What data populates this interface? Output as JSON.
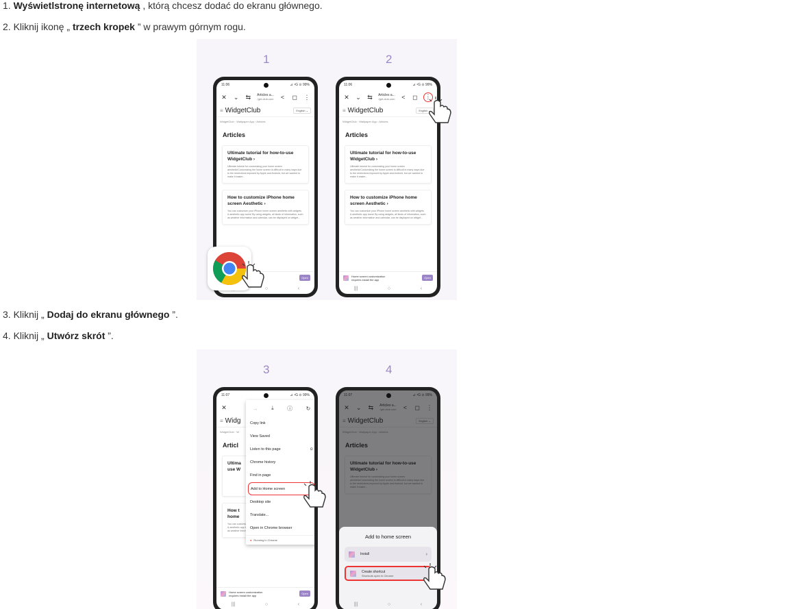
{
  "steps": [
    {
      "prefix": "1. ",
      "bold": "Wyświetlstronę internetową",
      "suffix": " , którą chcesz dodać do ekranu głównego."
    },
    {
      "prefix": "2. Kliknij ikonę „ ",
      "bold": "trzech kropek",
      "suffix": " ” w prawym górnym rogu."
    },
    {
      "prefix": "3. Kliknij „ ",
      "bold": "Dodaj do ekranu głównego",
      "suffix": " ”."
    },
    {
      "prefix": "4. Kliknij „ ",
      "bold": "Utwórz skrót",
      "suffix": " ”."
    }
  ],
  "figure_numbers": [
    "1",
    "2",
    "3",
    "4"
  ],
  "phone": {
    "status_time_a": "11:06",
    "status_time_b": "11:07",
    "status_right_a": "⊿ ⁴G ⊙ 99%",
    "status_right_b": "⊿ ⁴G ⊙ 99%",
    "url_title": "Articles a...",
    "url_domain": "/get-club.com",
    "brand": "WidgetClub",
    "brand_short": "Widg",
    "language": "English",
    "breadcrumb": "WidgetClub · Wallpaper App  ›  Articles",
    "breadcrumb_short": "WidgetClub · W",
    "articles_heading": "Articles",
    "articles_heading_short": "Articl",
    "card1_title": "Ultimate tutorial for how-to-use WidgetClub  ›",
    "card1_title_short_a": "Ultima",
    "card1_title_short_b": "use W",
    "card1_desc": "Ultimate tutorial for customizing your home screen aesthetic!Customizing the home screen is difficult in many ways due to the restrictions imposed by Apple and Android, but we wanted to make it easier...",
    "card2_title": "How to customize iPhone home screen Aesthetic  ›",
    "card2_title_short_a": "How t",
    "card2_title_short_b": "home",
    "card2_desc": "You can customize your iPhone home screen aesthetic with widgets & aesthetic app icons! By using widgets, all kinds of information, such as weather information and calendar, can be displayed on widget...",
    "card2_desc_short": "You can c",
    "banner_text_1": "Home screen customization",
    "banner_text_2": "requires install the app",
    "banner_button": "Open",
    "nav_recent": "|||",
    "nav_home": "○",
    "nav_back": "‹"
  },
  "menu": {
    "items": [
      "Copy link",
      "View Saved",
      "Listen to this page",
      "Chrome history",
      "Find in page",
      "Add to Home screen",
      "Desktop site",
      "Translate...",
      "Open in Chrome browser"
    ],
    "footer": "Running in Chrome"
  },
  "sheet": {
    "title": "Add to home screen",
    "install": "Install",
    "shortcut": "Create shortcut",
    "shortcut_sub": "Shortcuts open in Chrome"
  },
  "colors": {
    "accent_purple": "#9b87c8",
    "highlight_red": "#e33333"
  }
}
